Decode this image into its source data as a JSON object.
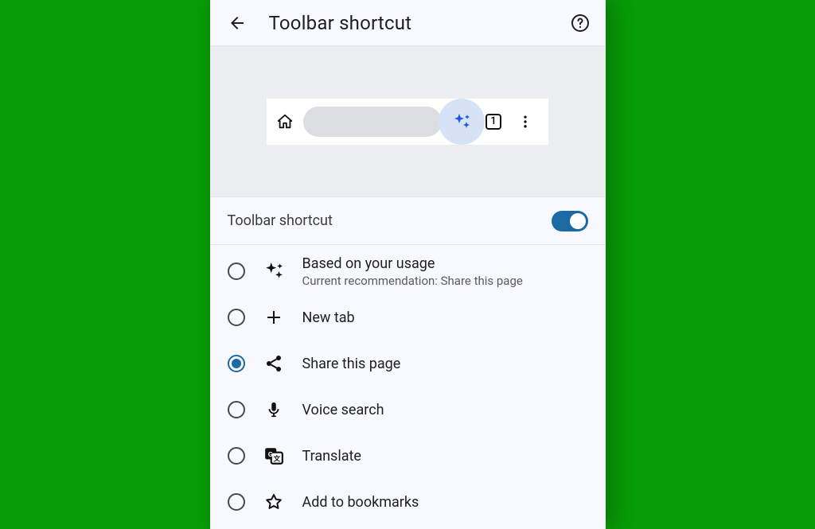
{
  "header": {
    "title": "Toolbar shortcut"
  },
  "preview": {
    "tab_count": "1"
  },
  "toggle": {
    "label": "Toolbar shortcut",
    "enabled": true
  },
  "options": [
    {
      "id": "usage",
      "icon": "sparkle-icon",
      "title": "Based on your usage",
      "subtitle": "Current recommendation:  Share this page",
      "selected": false
    },
    {
      "id": "newtab",
      "icon": "plus-icon",
      "title": "New tab",
      "selected": false
    },
    {
      "id": "share",
      "icon": "share-icon",
      "title": "Share this page",
      "selected": true
    },
    {
      "id": "voice",
      "icon": "mic-icon",
      "title": "Voice search",
      "selected": false
    },
    {
      "id": "translate",
      "icon": "translate-icon",
      "title": "Translate",
      "selected": false
    },
    {
      "id": "bookmark",
      "icon": "star-icon",
      "title": "Add to bookmarks",
      "selected": false
    }
  ]
}
